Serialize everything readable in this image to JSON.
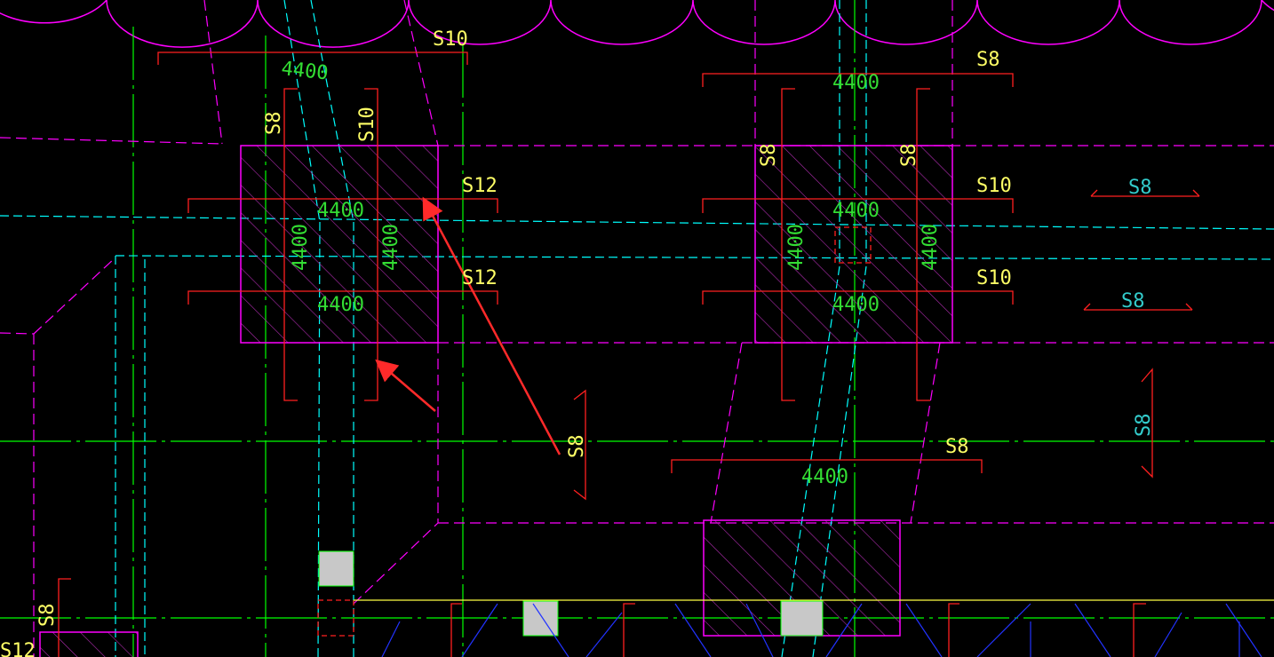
{
  "colors": {
    "background": "#000000",
    "grid_axis": "#00ff00",
    "beam_outline": "#ff00ff",
    "foundation_hatch": "#cc33cc",
    "rebar": "#ff2020",
    "dashed_cyan": "#00ffff",
    "column_fill": "#c8c8c8",
    "text_yellow": "#ffff66",
    "text_green": "#33dd33",
    "text_cyan": "#33cccc",
    "arrow": "#ff2a2a",
    "blue_hatch": "#2233ff",
    "yellow_line": "#ffff44"
  },
  "labels": {
    "s10_top": "S10",
    "dim_top_left": "4400",
    "s8_left_vert": "S8",
    "s10_left_vert": "S10",
    "s12_upper": "S12",
    "s12_lower": "S12",
    "dim_inner_top_left": "4400",
    "dim_inner_bottom_left": "4400",
    "dim_vert_left_a": "4400",
    "dim_vert_left_b": "4400",
    "s8_top_right": "S8",
    "dim_top_right": "4400",
    "s8_right_vert_a": "S8",
    "s8_right_vert_b": "S8",
    "s10_right_upper": "S10",
    "s10_right_lower": "S10",
    "dim_inner_top_right": "4400",
    "dim_inner_bottom_right": "4400",
    "dim_vert_right_a": "4400",
    "dim_vert_right_b": "4400",
    "s8_far_right_upper": "S8",
    "s8_far_right_lower": "S8",
    "s8_center_vert": "S8",
    "s8_mid": "S8",
    "dim_mid": "4400",
    "s8_far_right_vert": "S8",
    "s8_bottom_left": "S8",
    "s12_bottom_left": "S12"
  }
}
